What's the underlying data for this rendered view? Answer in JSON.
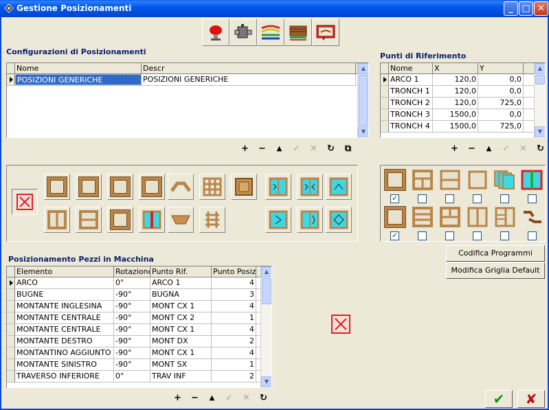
{
  "window": {
    "title": "Gestione Posizionamenti"
  },
  "titlebar_buttons": {
    "minimize": "_",
    "maximize": "□",
    "close": "✕"
  },
  "toolbar": {
    "icons": [
      "robot-icon",
      "machine-icon",
      "layers-icon",
      "profile-icon",
      "program-icon"
    ]
  },
  "configurazioni": {
    "title": "Configurazioni di Posizionamenti",
    "columns": [
      "Nome",
      "Descr"
    ],
    "rows": [
      {
        "nome": "POSIZIONI GENERICHE",
        "descr": "POSIZIONI GENERICHE"
      }
    ]
  },
  "punti": {
    "title": "Punti di Riferimento",
    "columns": [
      "Nome",
      "X",
      "Y"
    ],
    "rows": [
      {
        "nome": "ARCO 1",
        "x": "120,0",
        "y": "0,0"
      },
      {
        "nome": "TRONCH 1",
        "x": "120,0",
        "y": "0,0"
      },
      {
        "nome": "TRONCH 2",
        "x": "120,0",
        "y": "725,0"
      },
      {
        "nome": "TRONCH 3",
        "x": "1500,0",
        "y": "0,0"
      },
      {
        "nome": "TRONCH 4",
        "x": "1500,0",
        "y": "725,0"
      }
    ]
  },
  "nav": {
    "add": "+",
    "delete": "−",
    "first": "▲",
    "post": "✓",
    "cancel": "✕",
    "refresh": "↻",
    "copy": "⧉"
  },
  "pezzi": {
    "title": "Posizionamento Pezzi in Macchina",
    "columns": [
      "Elemento",
      "Rotazione",
      "Punto Rif.",
      "Punto Posiz."
    ],
    "rows": [
      {
        "elemento": "ARCO",
        "rotazione": "0°",
        "punto_rif": "ARCO 1",
        "punto_posiz": "4"
      },
      {
        "elemento": "BUGNE",
        "rotazione": "-90°",
        "punto_rif": "BUGNA",
        "punto_posiz": "3"
      },
      {
        "elemento": "MONTANTE INGLESINA",
        "rotazione": "-90°",
        "punto_rif": "MONT CX 1",
        "punto_posiz": "4"
      },
      {
        "elemento": "MONTANTE CENTRALE",
        "rotazione": "-90°",
        "punto_rif": "MONT CX 2",
        "punto_posiz": "1"
      },
      {
        "elemento": "MONTANTE CENTRALE",
        "rotazione": "-90°",
        "punto_rif": "MONT CX 1",
        "punto_posiz": "4"
      },
      {
        "elemento": "MONTANTE DESTRO",
        "rotazione": "-90°",
        "punto_rif": "MONT DX",
        "punto_posiz": "2"
      },
      {
        "elemento": "MONTANTINO AGGIUNTO",
        "rotazione": "-90°",
        "punto_rif": "MONT CX 1",
        "punto_posiz": "4"
      },
      {
        "elemento": "MONTANTE SINISTRO",
        "rotazione": "-90°",
        "punto_rif": "MONT SX",
        "punto_posiz": "1"
      },
      {
        "elemento": "TRAVERSO INFERIORE",
        "rotazione": "0°",
        "punto_rif": "TRAV INF",
        "punto_posiz": "2"
      }
    ]
  },
  "filter_checks": {
    "row1": [
      true,
      false,
      false,
      false,
      false,
      false
    ],
    "row2": [
      true,
      false,
      false,
      false,
      false,
      false
    ]
  },
  "buttons": {
    "codifica": "Codifica Programmi",
    "modifica": "Modifica Griglia Default",
    "ok": "✔",
    "cancel": "✘"
  },
  "colors": {
    "accent": "#0b1e6b",
    "selection": "#316ac5",
    "wood": "#b8864a",
    "glass": "#3fd6e6"
  }
}
